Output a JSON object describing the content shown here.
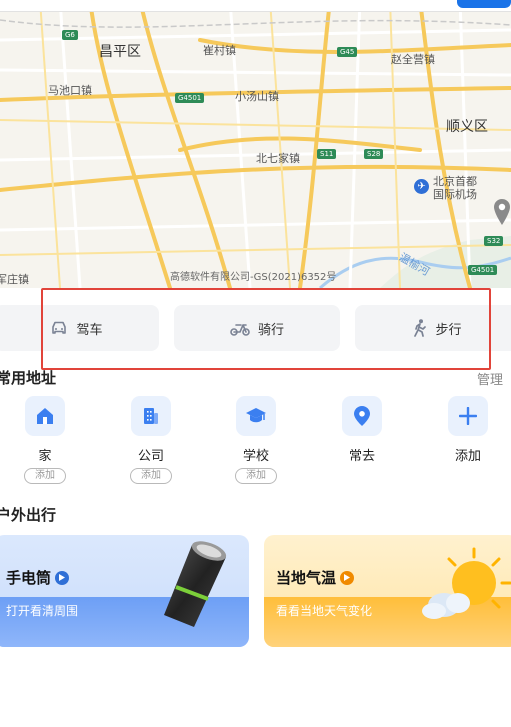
{
  "map": {
    "labels": {
      "changping": "昌平区",
      "cuicun": "崔村镇",
      "zhaoquanying": "赵全营镇",
      "machikou": "马池口镇",
      "xiaotangshan": "小汤山镇",
      "shunyi": "顺义区",
      "beiqijia": "北七家镇",
      "airport": "北京首都国际机场",
      "wenyuhe": "温榆河",
      "yangfang": "军庄镇"
    },
    "shields": {
      "g6": "G6",
      "g45": "G45",
      "g4501a": "G4501",
      "s11": "S11",
      "s28": "S28",
      "s32": "S32",
      "g4501b": "G4501"
    },
    "copyright": "高德软件有限公司-GS(2021)6352号"
  },
  "modes": {
    "drive": "驾车",
    "ride": "骑行",
    "walk": "步行"
  },
  "common": {
    "title": "常用地址",
    "manage": "管理",
    "items": [
      {
        "label": "家",
        "tag": "添加"
      },
      {
        "label": "公司",
        "tag": "添加"
      },
      {
        "label": "学校",
        "tag": "添加"
      },
      {
        "label": "常去"
      },
      {
        "label": "添加"
      }
    ]
  },
  "outdoor": {
    "title": "户外出行",
    "cards": [
      {
        "title": "手电筒",
        "subtitle": "打开看清周围"
      },
      {
        "title": "当地气温",
        "subtitle": "看看当地天气变化"
      }
    ]
  },
  "colors": {
    "accent": "#2f6fd6",
    "highlight": "#e1443a",
    "orange": "#f08a00"
  }
}
